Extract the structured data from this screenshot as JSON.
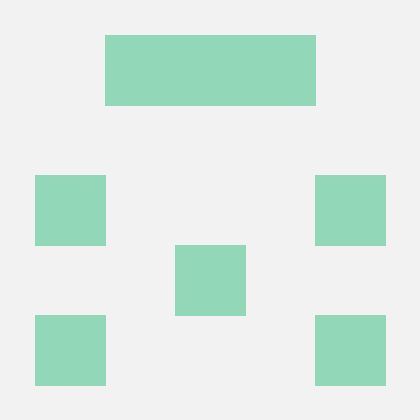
{
  "identicon": {
    "background_color": "#f2f2f2",
    "block_color": "#92d7b7"
  }
}
